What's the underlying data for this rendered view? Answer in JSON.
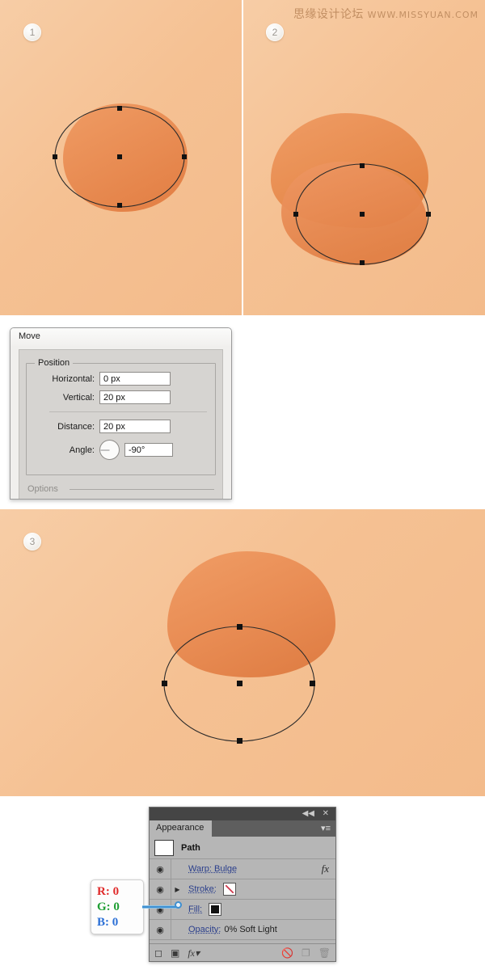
{
  "watermark": {
    "cn": "思缘设计论坛",
    "url": "WWW.MISSYUAN.COM"
  },
  "steps": [
    {
      "badge": "1"
    },
    {
      "badge": "2"
    },
    {
      "badge": "3"
    }
  ],
  "move_dialog": {
    "title": "Move",
    "position_legend": "Position",
    "horizontal_label": "Horizontal:",
    "horizontal_value": "0 px",
    "vertical_label": "Vertical:",
    "vertical_value": "20 px",
    "distance_label": "Distance:",
    "distance_value": "20 px",
    "angle_label": "Angle:",
    "angle_value": "-90°",
    "options_legend": "Options"
  },
  "appearance": {
    "tab_label": "Appearance",
    "collapse_icon": "◀◀",
    "close_icon": "✕",
    "menu_icon": "▾≡",
    "target_title": "Path",
    "rows": [
      {
        "label": "Warp: Bulge",
        "eye": "◉",
        "fx": "fx",
        "has_arrow": false,
        "swatch": "none",
        "value": ""
      },
      {
        "label": "Stroke:",
        "eye": "◉",
        "fx": "",
        "has_arrow": true,
        "swatch": "none-slash",
        "value": ""
      },
      {
        "label": "Fill:",
        "eye": "◉",
        "fx": "",
        "has_arrow": false,
        "swatch": "black",
        "value": ""
      },
      {
        "label": "Opacity:",
        "eye": "◉",
        "fx": "",
        "has_arrow": false,
        "swatch": "",
        "value": "0% Soft Light"
      }
    ],
    "bottom_icons": [
      {
        "name": "add-new-stroke-icon",
        "glyph": "◻"
      },
      {
        "name": "add-new-fill-icon",
        "glyph": "▣"
      },
      {
        "name": "add-new-effect-icon",
        "glyph": "fx▾"
      },
      {
        "name": "clear-appearance-icon",
        "glyph": "🚫"
      },
      {
        "name": "duplicate-item-icon",
        "glyph": "❐"
      },
      {
        "name": "delete-item-icon",
        "glyph": "🗑"
      }
    ]
  },
  "rgb_callout": {
    "r_label": "R:",
    "r_value": "0",
    "g_label": "G:",
    "g_value": "0",
    "b_label": "B:",
    "b_value": "0"
  },
  "colors": {
    "canvas_bg": "#f5c193",
    "shape_fill": "#ea8e52",
    "accent_blue": "#2b3f8c",
    "callout_blue": "#3f8fd0",
    "panel_gray": "#b6b6b6"
  }
}
